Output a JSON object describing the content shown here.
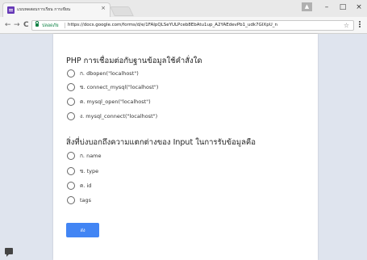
{
  "browser": {
    "tab_title": "แบบทดสอบการเรียน การเขียน",
    "tab_close": "×",
    "window_controls": [
      "–",
      "□",
      "×"
    ],
    "security_label": "ปลอดภัย",
    "url": "https://docs.google.com/forms/d/e/1FAIpQLSeYULPceb8EbAtu1up_A2YAEdevPb1_udk7GIXpU_n",
    "star": "☆",
    "nav": {
      "back": "←",
      "forward": "→",
      "reload": "C"
    }
  },
  "form": {
    "questions": [
      {
        "title": "PHP การเชื่อมต่อกับฐานข้อมูลใช้คำสั่งใด",
        "options": [
          "ก. dbopen(\"localhost\")",
          "ข. connect_mysql(\"localhost\")",
          "ค. mysql_open(\"localhost\")",
          "ง. mysql_connect(\"localhost\")"
        ]
      },
      {
        "title": "สิ่งที่บ่งบอกถึงความแตกต่างของ Input ในการรับข้อมูลคือ",
        "options": [
          "ก. name",
          "ข. type",
          "ค. id",
          "tags"
        ]
      }
    ],
    "submit_label": "ส่ง"
  },
  "colors": {
    "accent": "#4285f4",
    "background": "#dfe4ee",
    "secure_green": "#0b8043",
    "form_icon": "#673ab7"
  }
}
